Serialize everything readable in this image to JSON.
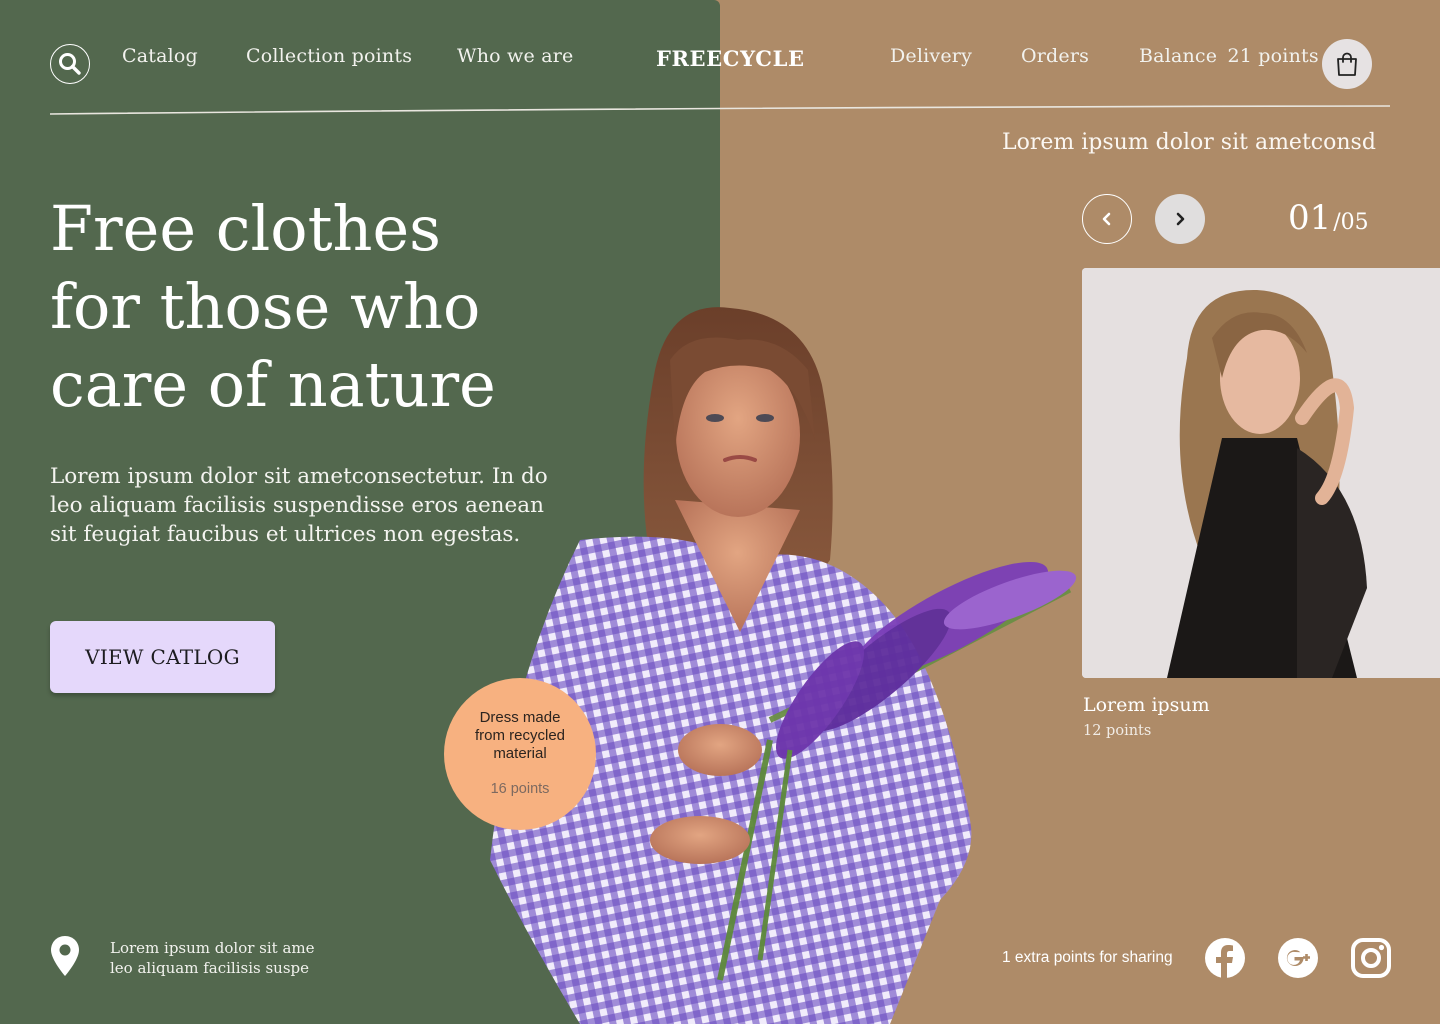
{
  "brand": "FREECYCLE",
  "nav": {
    "left": [
      "Catalog",
      "Collection points",
      "Who we are"
    ],
    "right": [
      "Delivery",
      "Orders"
    ],
    "balance_label": "Balance",
    "balance_value": "21 points"
  },
  "hero": {
    "title_lines": [
      "Free clothes",
      "for those who",
      "care of nature"
    ],
    "description": "Lorem ipsum dolor sit ametconsectetur. In do leo aliquam facilisis suspendisse eros aenean sit feugiat faucibus et ultrices non egestas.",
    "cta_label": "VIEW CATLOG"
  },
  "featured_product": {
    "description": "Dress  made from recycled material",
    "points": "16 points"
  },
  "slider": {
    "tagline": "Lorem ipsum dolor sit ametconsd",
    "current": "01",
    "total": "/05",
    "card": {
      "title": "Lorem ipsum",
      "points": "12 points"
    }
  },
  "footer": {
    "address_lines": [
      "Lorem ipsum dolor sit ame",
      "leo aliquam facilisis suspe"
    ],
    "share_text": "1 extra points for sharing",
    "social_icons": [
      "facebook-icon",
      "google-plus-icon",
      "instagram-icon"
    ]
  },
  "colors": {
    "left_panel": "#53684e",
    "right_panel": "#ae8b68",
    "cta": "#e5d8fb",
    "badge": "#f7b180"
  }
}
